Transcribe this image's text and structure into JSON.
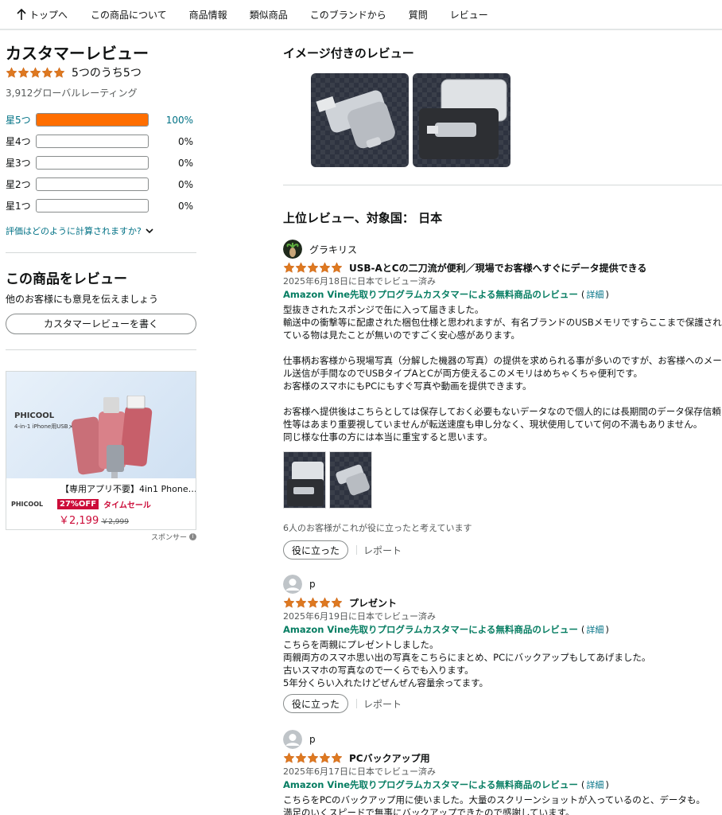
{
  "nav": {
    "items": [
      "トップへ",
      "この商品について",
      "商品情報",
      "類似商品",
      "このブランドから",
      "質問",
      "レビュー"
    ]
  },
  "summary": {
    "title": "カスタマーレビュー",
    "rating_text": "5つのうち5つ",
    "rating": 5,
    "global_count": "3,912グローバルレーティング",
    "histogram": [
      {
        "label": "星5つ",
        "pct": "100%",
        "value": 100
      },
      {
        "label": "星4つ",
        "pct": "0%",
        "value": 0
      },
      {
        "label": "星3つ",
        "pct": "0%",
        "value": 0
      },
      {
        "label": "星2つ",
        "pct": "0%",
        "value": 0
      },
      {
        "label": "星1つ",
        "pct": "0%",
        "value": 0
      }
    ],
    "how_calculated": "評価はどのように計算されますか?"
  },
  "write_review": {
    "title": "この商品をレビュー",
    "text": "他のお客様にも意見を伝えましょう",
    "button": "カスタマーレビューを書く"
  },
  "ad": {
    "brand": "PHICOOL",
    "brand_sub": "4-in-1 iPhone用USBメモリ",
    "title": "【専用アプリ不要】4in1 Phone…",
    "logo": "PHICOOL",
    "discount": "27%OFF",
    "sale": "タイムセール",
    "price": "￥2,199",
    "old_price": "￥2,999",
    "sponsor": "スポンサー"
  },
  "images_section": {
    "title": "イメージ付きのレビュー"
  },
  "top_reviews_title": "上位レビュー、対象国： 日本",
  "reviews": [
    {
      "name": "グラキリス",
      "rating": 5,
      "title": "USB-AとCの二刀流が便利／現場でお客様へすぐにデータ提供できる",
      "date": "2025年6月18日に日本でレビュー済み",
      "vine_a": "Amazon Vine先取りプログラムカスタマーによる無料商品のレビュー",
      "vine_b": "(",
      "vine_c": "詳細",
      "vine_d": ")",
      "lines": [
        "型抜きされたスポンジで缶に入って届きました。",
        "輸送中の衝撃等に配慮された梱包仕様と思われますが、有名ブランドのUSBメモリですらここまで保護され",
        "ている物は見たことが無いのですごく安心感があります。",
        "",
        "仕事柄お客様から現場写真（分解した機器の写真）の提供を求められる事が多いのですが、お客様へのメー",
        "ル送信が手間なのでUSBタイプAとCが両方使えるこのメモリはめちゃくちゃ便利です。",
        "お客様のスマホにもPCにもすぐ写真や動画を提供できます。",
        "",
        "お客様へ提供後はこちらとしては保存しておく必要もないデータなので個人的には長期間のデータ保存信頼",
        "性等はあまり重要視していませんが転送速度も申し分なく、現状使用していて何の不満もありません。",
        "同じ様な仕事の方には本当に重宝すると思います。"
      ],
      "helpful": "6人のお客様がこれが役に立ったと考えています",
      "helpful_btn": "役に立った",
      "report": "レポート"
    },
    {
      "name": "p",
      "rating": 5,
      "title": "プレゼント",
      "date": "2025年6月19日に日本でレビュー済み",
      "vine_a": "Amazon Vine先取りプログラムカスタマーによる無料商品のレビュー",
      "vine_b": "(",
      "vine_c": "詳細",
      "vine_d": ")",
      "lines": [
        "こちらを両親にプレゼントしました。",
        "両親両方のスマホ思い出の写真をこちらにまとめ、PCにバックアップもしてあげました。",
        "古いスマホの写真なので一くらでも入ります。",
        "5年分くらい入れたけどぜんぜん容量余ってます。"
      ],
      "helpful_btn": "役に立った",
      "report": "レポート"
    },
    {
      "name": "p",
      "rating": 5,
      "title": "PCバックアップ用",
      "date": "2025年6月17日に日本でレビュー済み",
      "vine_a": "Amazon Vine先取りプログラムカスタマーによる無料商品のレビュー",
      "vine_b": "(",
      "vine_c": "詳細",
      "vine_d": ")",
      "lines": [
        "こちらをPCのバックアップ用に使いました。大量のスクリーンショットが入っているのと、データも。",
        "満足のいくスピードで無事にバックアップできたので感謝しています。"
      ]
    }
  ],
  "colors": {
    "star": "#de7921",
    "bar_fill": "#ff6e00",
    "link": "#007185",
    "vine": "#067d62"
  }
}
